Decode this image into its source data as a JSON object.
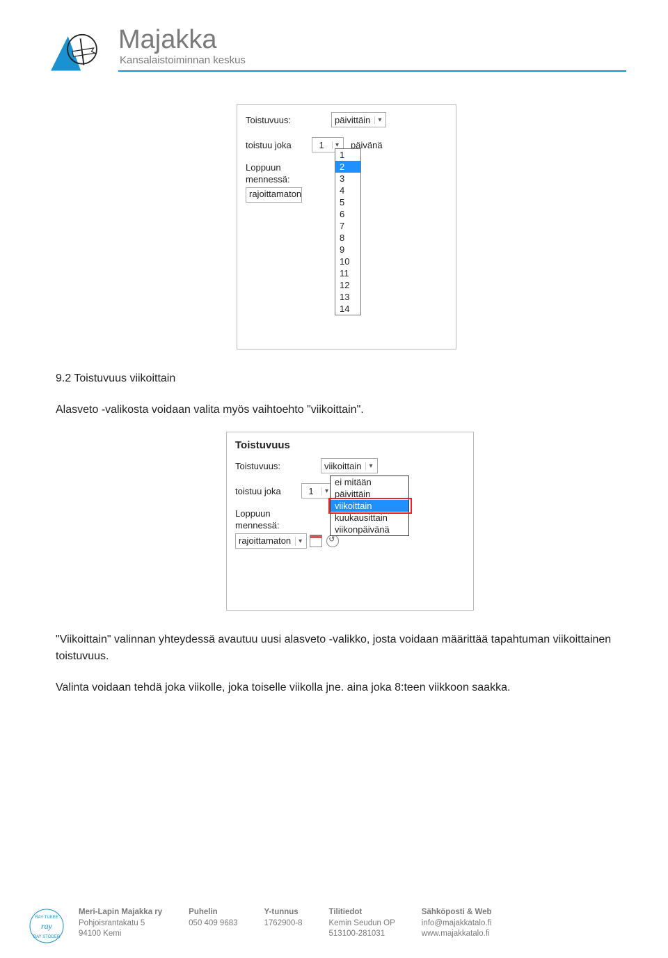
{
  "header": {
    "title": "Majakka",
    "subtitle": "Kansalaistoiminnan keskus"
  },
  "shot1": {
    "toistuvuus_label": "Toistuvuus:",
    "toistuvuus_value": "päivittäin",
    "toistuu_label1": "toistuu joka",
    "toistuu_value": "1",
    "toistuu_label2": "päivänä",
    "loppuun_label1": "Loppuun",
    "loppuun_label2": "mennessä:",
    "loppuun_value": "rajoittamaton",
    "dropdown_options": [
      "1",
      "2",
      "3",
      "4",
      "5",
      "6",
      "7",
      "8",
      "9",
      "10",
      "11",
      "12",
      "13",
      "14"
    ],
    "dropdown_selected_index": 1
  },
  "section_title": "9.2 Toistuvuus viikoittain",
  "para1": "Alasveto -valikosta voidaan valita myös vaihtoehto \"viikoittain\".",
  "shot2": {
    "legend": "Toistuvuus",
    "toistuvuus_label": "Toistuvuus:",
    "toistuvuus_value": "viikoittain",
    "toistuu_label1": "toistuu joka",
    "toistuu_value": "1",
    "loppuun_label1": "Loppuun",
    "loppuun_label2": "mennessä:",
    "loppuun_value": "rajoittamaton",
    "dropdown_options": [
      "ei mitään",
      "päivittäin",
      "viikoittain",
      "kuukausittain",
      "viikonpäivänä"
    ],
    "dropdown_selected_index": 2
  },
  "para2": "\"Viikoittain\" valinnan yhteydessä avautuu uusi alasveto -valikko, josta voidaan määrittää tapahtuman viikoittainen toistuvuus.",
  "para3": "Valinta voidaan tehdä joka viikolle, joka toiselle viikolla jne. aina joka 8:teen viikkoon saakka.",
  "footer": {
    "org": {
      "h": "Meri-Lapin Majakka ry",
      "l1": "Pohjoisrantakatu 5",
      "l2": "94100 Kemi"
    },
    "phone": {
      "h": "Puhelin",
      "l1": "050 409 9683"
    },
    "yt": {
      "h": "Y-tunnus",
      "l1": "1762900-8"
    },
    "bank": {
      "h": "Tilitiedot",
      "l1": "Kemin Seudun OP",
      "l2": "513100-281031"
    },
    "web": {
      "h": "Sähköposti & Web",
      "l1": "info@majakkatalo.fi",
      "l2": "www.majakkatalo.fi"
    }
  }
}
